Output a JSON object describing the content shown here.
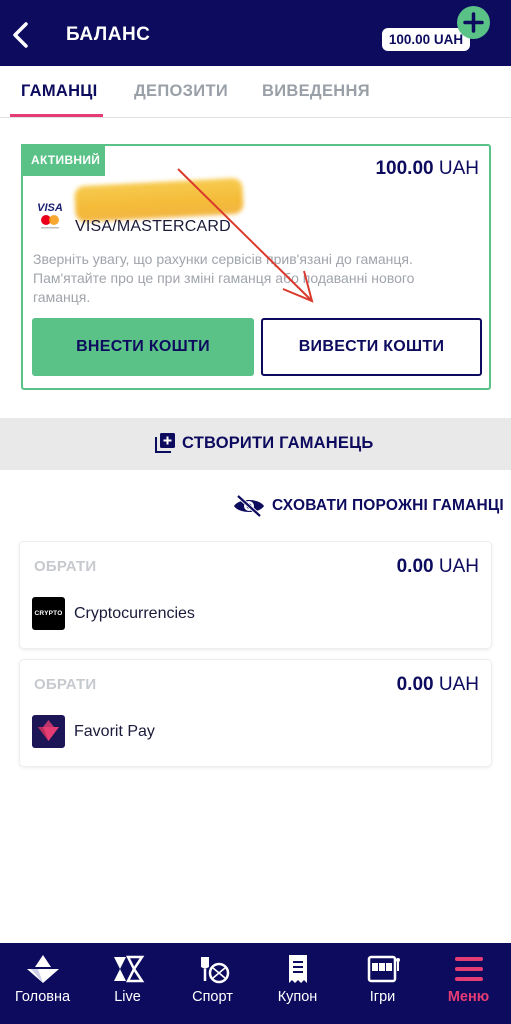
{
  "header": {
    "title": "БАЛАНС",
    "balance": "100.00 UAH",
    "back_icon": "chevron-left-icon",
    "add_icon": "plus-circle-icon"
  },
  "tabs": [
    {
      "label": "ГАМАНЦІ",
      "active": true
    },
    {
      "label": "ДЕПОЗИТИ",
      "active": false
    },
    {
      "label": "ВИВЕДЕННЯ",
      "active": false
    }
  ],
  "active_wallet": {
    "badge": "АКТИВНИЙ",
    "amount": "100.00",
    "currency": "UAH",
    "card_type": "VISA/MASTERCARD",
    "logo_text": "VISA",
    "notice": "Зверніть увагу, що рахунки сервісів прив'язані до гаманця. Пам'ятайте про це при зміні гаманця або подаванні нового гаманця.",
    "deposit_label": "ВНЕСТИ КОШТИ",
    "withdraw_label": "ВИВЕСТИ КОШТИ"
  },
  "create_wallet": {
    "label": "СТВОРИТИ ГАМАНЕЦЬ",
    "icon": "add-box-icon"
  },
  "hide_empty": {
    "label": "СХОВАТИ ПОРОЖНІ ГАМАНЦІ",
    "icon": "eye-off-icon"
  },
  "wallets": [
    {
      "select_label": "ОБРАТИ",
      "amount": "0.00",
      "currency": "UAH",
      "name": "Cryptocurrencies",
      "logo_text": "CRYPTO"
    },
    {
      "select_label": "ОБРАТИ",
      "amount": "0.00",
      "currency": "UAH",
      "name": "Favorit Pay"
    }
  ],
  "nav": [
    {
      "label": "Головна",
      "icon": "home-icon",
      "active": false
    },
    {
      "label": "Live",
      "icon": "live-icon",
      "active": false
    },
    {
      "label": "Спорт",
      "icon": "sport-icon",
      "active": false
    },
    {
      "label": "Купон",
      "icon": "coupon-icon",
      "active": false
    },
    {
      "label": "Ігри",
      "icon": "slot-machine-icon",
      "active": false
    },
    {
      "label": "Меню",
      "icon": "menu-icon",
      "active": true
    }
  ],
  "colors": {
    "primary": "#0d0b5e",
    "accent_green": "#5ac187",
    "accent_pink": "#e53d73",
    "muted": "#9aa0a8"
  }
}
